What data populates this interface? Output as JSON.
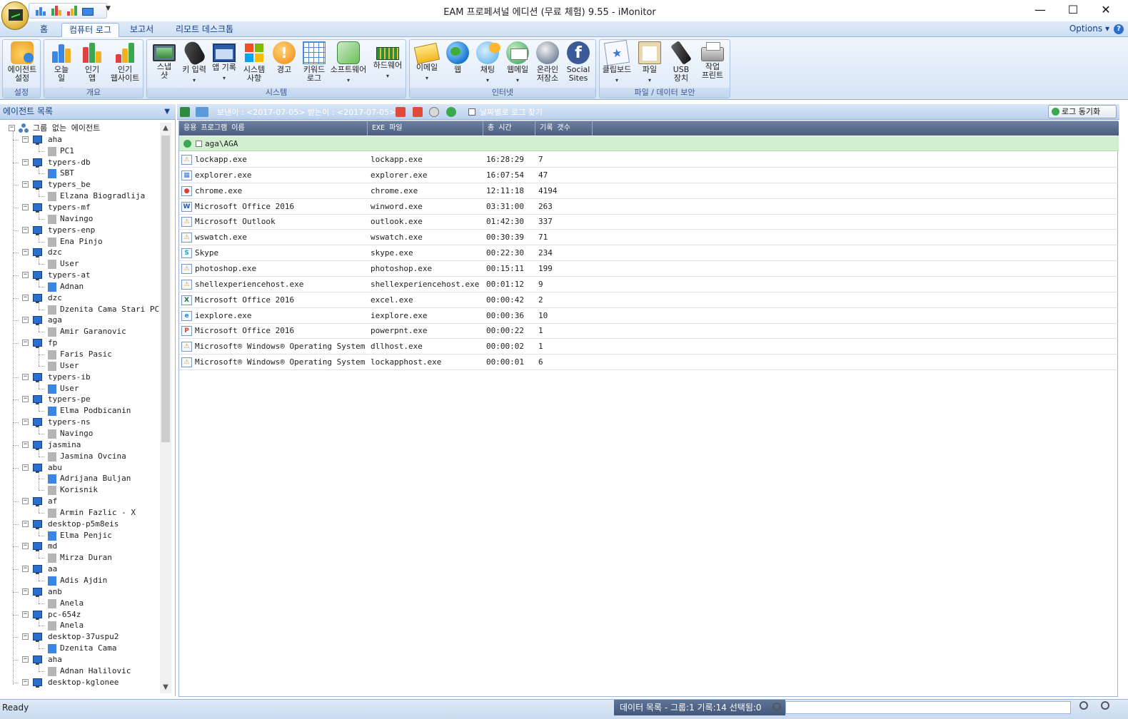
{
  "window": {
    "title": "EAM 프로페셔널 에디션 (무료 체험) 9.55 - iMonitor",
    "minimize": "—",
    "maximize": "☐",
    "close": "✕"
  },
  "ribbon": {
    "tabs": [
      "홈",
      "컴퓨터 로그",
      "보고서",
      "리모트 데스크톱"
    ],
    "active_tab": "컴퓨터 로그",
    "options_label": "Options",
    "help_icon": "?",
    "groups": {
      "settings": {
        "label": "설정",
        "buttons": [
          "에이전트\n설정"
        ]
      },
      "overview": {
        "label": "개요",
        "buttons": [
          "오늘\n일",
          "인기\n앱",
          "인기\n웹사이트"
        ]
      },
      "system": {
        "label": "시스템",
        "buttons": [
          "스냅\n샷",
          "키 입력",
          "앱 기록",
          "시스템\n사항",
          "경고",
          "키워드\n로그",
          "소프트웨어",
          "하드웨어"
        ]
      },
      "internet": {
        "label": "인터넷",
        "buttons": [
          "이메일",
          "웹",
          "채팅",
          "웹메일",
          "온라인\n저장소",
          "Social\nSites"
        ]
      },
      "file_security": {
        "label": "파일 / 데이터 보안",
        "buttons": [
          "클립보드",
          "파일",
          "USB\n장치",
          "작업\n프린트"
        ]
      }
    }
  },
  "left_panel": {
    "title": "에이전트 목록",
    "root": "그룹 없는 에이전트",
    "computers": [
      {
        "name": "aha",
        "users": [
          {
            "name": "PC1",
            "online": false
          }
        ]
      },
      {
        "name": "typers-db",
        "users": [
          {
            "name": "SBT",
            "online": true
          }
        ]
      },
      {
        "name": "typers_be",
        "users": [
          {
            "name": "Elzana Biogradlija",
            "online": false
          }
        ]
      },
      {
        "name": "typers-mf",
        "users": [
          {
            "name": "Navingo",
            "online": false
          }
        ]
      },
      {
        "name": "typers-enp",
        "users": [
          {
            "name": "Ena Pinjo",
            "online": false
          }
        ]
      },
      {
        "name": "dzc",
        "users": [
          {
            "name": "User",
            "online": false
          }
        ]
      },
      {
        "name": "typers-at",
        "users": [
          {
            "name": "Adnan",
            "online": true
          }
        ]
      },
      {
        "name": "dzc",
        "users": [
          {
            "name": "Dzenita Cama Stari PC",
            "online": false
          }
        ]
      },
      {
        "name": "aga",
        "users": [
          {
            "name": "Amir Garanovic",
            "online": false
          }
        ]
      },
      {
        "name": "fp",
        "users": [
          {
            "name": "Faris Pasic",
            "online": false
          },
          {
            "name": "User",
            "online": false
          }
        ]
      },
      {
        "name": "typers-ib",
        "users": [
          {
            "name": "User",
            "online": true
          }
        ]
      },
      {
        "name": "typers-pe",
        "users": [
          {
            "name": "Elma Podbicanin",
            "online": true
          }
        ]
      },
      {
        "name": "typers-ns",
        "users": [
          {
            "name": "Navingo",
            "online": false
          }
        ]
      },
      {
        "name": "jasmina",
        "users": [
          {
            "name": "Jasmina Ovcina",
            "online": false
          }
        ]
      },
      {
        "name": "abu",
        "users": [
          {
            "name": "Adrijana Buljan",
            "online": true
          },
          {
            "name": "Korisnik",
            "online": false
          }
        ]
      },
      {
        "name": "af",
        "users": [
          {
            "name": "Armin Fazlic - X",
            "online": false
          }
        ]
      },
      {
        "name": "desktop-p5m8eis",
        "users": [
          {
            "name": "Elma Penjic",
            "online": true
          }
        ]
      },
      {
        "name": "md",
        "users": [
          {
            "name": "Mirza Duran",
            "online": false
          }
        ]
      },
      {
        "name": "aa",
        "users": [
          {
            "name": "Adis Ajdin",
            "online": true
          }
        ]
      },
      {
        "name": "anb",
        "users": [
          {
            "name": "Anela",
            "online": false
          }
        ]
      },
      {
        "name": "pc-654z",
        "users": [
          {
            "name": "Anela",
            "online": false
          }
        ]
      },
      {
        "name": "desktop-37uspu2",
        "users": [
          {
            "name": "Dzenita Cama",
            "online": true
          }
        ]
      },
      {
        "name": "aha",
        "users": [
          {
            "name": "Adnan Halilovic",
            "online": false
          }
        ]
      },
      {
        "name": "desktop-kglonee",
        "users": []
      }
    ]
  },
  "toolbar": {
    "date_range": "보낸이 : <2017-07-05> 받는이 : <2017-07-05>",
    "search_by_date": "날짜별로 로그 찾기",
    "sync_button": "로그 동기화"
  },
  "grid": {
    "columns": [
      "응용 프로그램 이름",
      "EXE 파일",
      "총 시간",
      "기록 갯수"
    ],
    "group_label": "aga\\AGA",
    "rows": [
      {
        "app": "lockapp.exe",
        "exe": "lockapp.exe",
        "time": "16:28:29",
        "count": "7",
        "icon": "app-icon",
        "icon_glyph": "⚠",
        "icon_color": "#e0a010"
      },
      {
        "app": "explorer.exe",
        "exe": "explorer.exe",
        "time": "16:07:54",
        "count": "47",
        "icon": "explorer-icon",
        "icon_glyph": "▦",
        "icon_color": "#3a7ad0"
      },
      {
        "app": "chrome.exe",
        "exe": "chrome.exe",
        "time": "12:11:18",
        "count": "4194",
        "icon": "chrome-icon",
        "icon_glyph": "●",
        "icon_color": "#d94030"
      },
      {
        "app": "Microsoft Office 2016",
        "exe": "winword.exe",
        "time": "03:31:00",
        "count": "263",
        "icon": "word-icon",
        "icon_glyph": "W",
        "icon_color": "#2b579a"
      },
      {
        "app": "Microsoft Outlook",
        "exe": "outlook.exe",
        "time": "01:42:30",
        "count": "337",
        "icon": "outlook-icon",
        "icon_glyph": "⚠",
        "icon_color": "#e0a010"
      },
      {
        "app": "wswatch.exe",
        "exe": "wswatch.exe",
        "time": "00:30:39",
        "count": "71",
        "icon": "app-icon",
        "icon_glyph": "⚠",
        "icon_color": "#e0a010"
      },
      {
        "app": "Skype",
        "exe": "skype.exe",
        "time": "00:22:30",
        "count": "234",
        "icon": "skype-icon",
        "icon_glyph": "S",
        "icon_color": "#00aff0"
      },
      {
        "app": "photoshop.exe",
        "exe": "photoshop.exe",
        "time": "00:15:11",
        "count": "199",
        "icon": "app-icon",
        "icon_glyph": "⚠",
        "icon_color": "#e0a010"
      },
      {
        "app": "shellexperiencehost.exe",
        "exe": "shellexperiencehost.exe",
        "time": "00:01:12",
        "count": "9",
        "icon": "app-icon",
        "icon_glyph": "⚠",
        "icon_color": "#e0a010"
      },
      {
        "app": "Microsoft Office 2016",
        "exe": "excel.exe",
        "time": "00:00:42",
        "count": "2",
        "icon": "excel-icon",
        "icon_glyph": "X",
        "icon_color": "#217346"
      },
      {
        "app": "iexplore.exe",
        "exe": "iexplore.exe",
        "time": "00:00:36",
        "count": "10",
        "icon": "ie-icon",
        "icon_glyph": "e",
        "icon_color": "#1e88e5"
      },
      {
        "app": "Microsoft Office 2016",
        "exe": "powerpnt.exe",
        "time": "00:00:22",
        "count": "1",
        "icon": "powerpoint-icon",
        "icon_glyph": "P",
        "icon_color": "#d24726"
      },
      {
        "app": "Microsoft® Windows® Operating System",
        "exe": "dllhost.exe",
        "time": "00:00:02",
        "count": "1",
        "icon": "app-icon",
        "icon_glyph": "⚠",
        "icon_color": "#e0a010"
      },
      {
        "app": "Microsoft® Windows® Operating System",
        "exe": "lockapphost.exe",
        "time": "00:00:01",
        "count": "6",
        "icon": "app-icon",
        "icon_glyph": "⚠",
        "icon_color": "#e0a010"
      }
    ]
  },
  "status": {
    "ready": "Ready",
    "info": "데이터 목록 - 그룹:1 기록:14 선택됨:0"
  },
  "colors": {
    "ribbon_blue": "#dfeaf8",
    "group_row_green": "#d2f0d0",
    "header_slate": "#5a6d8f"
  }
}
